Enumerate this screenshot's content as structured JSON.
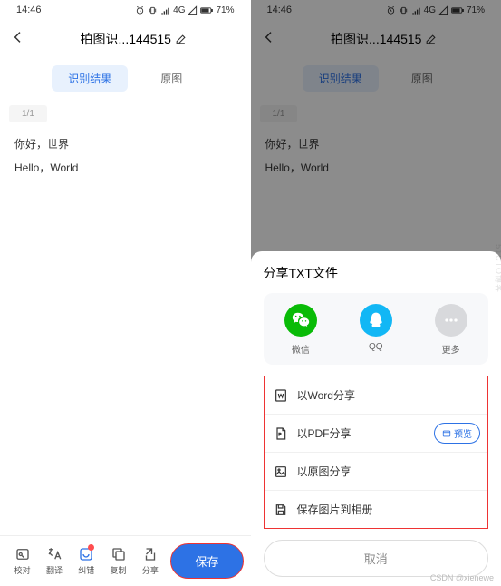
{
  "status": {
    "time": "14:46",
    "battery": "71%",
    "network": "4G"
  },
  "header": {
    "title": "拍图识...144515"
  },
  "tabs": {
    "result": "识别结果",
    "original": "原图"
  },
  "counter": "1/1",
  "content": {
    "line1": "你好，世界",
    "line2": "Hello，World"
  },
  "bottombar": {
    "proof": "校对",
    "translate": "翻译",
    "correct": "纠错",
    "copy": "复制",
    "share": "分享",
    "save": "保存"
  },
  "sheet": {
    "title": "分享TXT文件",
    "apps": {
      "wechat": "微信",
      "qq": "QQ",
      "more": "更多"
    },
    "opts": {
      "word": "以Word分享",
      "pdf": "以PDF分享",
      "image": "以原图分享",
      "save_img": "保存图片到相册"
    },
    "preview": "预览",
    "cancel": "取消"
  },
  "watermark": {
    "bottom": "CSDN @xienewe",
    "side": "51CTO博客"
  }
}
